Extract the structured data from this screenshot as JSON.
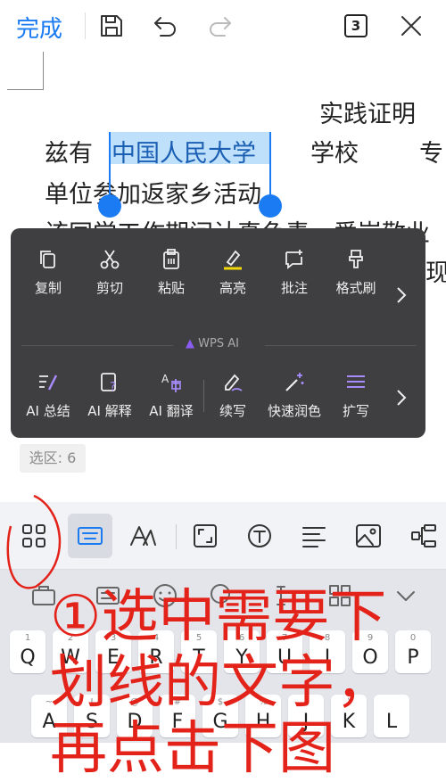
{
  "toolbar": {
    "done_label": "完成",
    "page_count": "3",
    "icons": [
      "save-icon",
      "undo-icon",
      "redo-icon",
      "page-count-icon",
      "close-icon"
    ]
  },
  "document": {
    "line1": "实践证明",
    "line2_prefix": "兹有",
    "line2_selected": "中国人民大学",
    "line2_school": "学校",
    "line2_tail": "专",
    "line3": "单位参加返家乡活动。",
    "line4": "该同学工作期间认真负责，爱岗敬业",
    "line5_tail": "表现"
  },
  "context_menu": {
    "row1": [
      {
        "label": "复制",
        "icon": "copy-icon"
      },
      {
        "label": "剪切",
        "icon": "scissors-icon"
      },
      {
        "label": "粘贴",
        "icon": "paste-icon"
      },
      {
        "label": "高亮",
        "icon": "highlight-icon"
      },
      {
        "label": "批注",
        "icon": "comment-icon"
      },
      {
        "label": "格式刷",
        "icon": "format-brush-icon"
      }
    ],
    "ai_section_label": "WPS AI",
    "row2": [
      {
        "label": "AI 总结",
        "icon": "ai-summary-icon"
      },
      {
        "label": "AI 解释",
        "icon": "ai-explain-icon"
      },
      {
        "label": "AI 翻译",
        "icon": "ai-translate-icon"
      },
      {
        "label": "续写",
        "icon": "continue-writing-icon"
      },
      {
        "label": "快速润色",
        "icon": "magic-wand-icon"
      },
      {
        "label": "扩写",
        "icon": "expand-icon"
      }
    ]
  },
  "selection_badge": "选区: 6",
  "format_toolbar": {
    "icons": [
      "apps-grid-icon",
      "keyboard-icon",
      "text-style-icon",
      "crop-icon",
      "text-box-icon",
      "align-icon",
      "image-icon",
      "more-options-icon"
    ]
  },
  "keyboard": {
    "toolbar_icons": [
      "briefcase-icon",
      "keyboard-switch-icon",
      "emoji-icon",
      "mic-icon",
      "cursor-icon",
      "grid-icon",
      "collapse-icon"
    ],
    "row1": [
      {
        "num": "1",
        "ch": "Q"
      },
      {
        "num": "2",
        "ch": "W"
      },
      {
        "num": "3",
        "ch": "E"
      },
      {
        "num": "4",
        "ch": "R"
      },
      {
        "num": "5",
        "ch": "T"
      },
      {
        "num": "6",
        "ch": "Y"
      },
      {
        "num": "7",
        "ch": "U"
      },
      {
        "num": "8",
        "ch": "I"
      },
      {
        "num": "9",
        "ch": "O"
      },
      {
        "num": "0",
        "ch": "P"
      }
    ],
    "row2": [
      {
        "num": "~",
        "ch": "A"
      },
      {
        "num": "!",
        "ch": "S"
      },
      {
        "num": "@",
        "ch": "D"
      },
      {
        "num": "#",
        "ch": "F"
      },
      {
        "num": "$",
        "ch": "G"
      },
      {
        "num": "%",
        "ch": "H"
      },
      {
        "num": "(",
        "ch": "J"
      },
      {
        "num": ")",
        "ch": "K"
      },
      {
        "num": "",
        "ch": "L"
      }
    ]
  },
  "annotation": {
    "line1": "①选中需要下",
    "line2": "划线的文字，",
    "line3": "再点击下图"
  },
  "colors": {
    "accent": "#1a7bf2",
    "menu_bg": "#3f3f41",
    "annotation_red": "#e3221a",
    "highlight_yellow": "#f2d70a",
    "ai_purple": "#8b5cf6"
  }
}
